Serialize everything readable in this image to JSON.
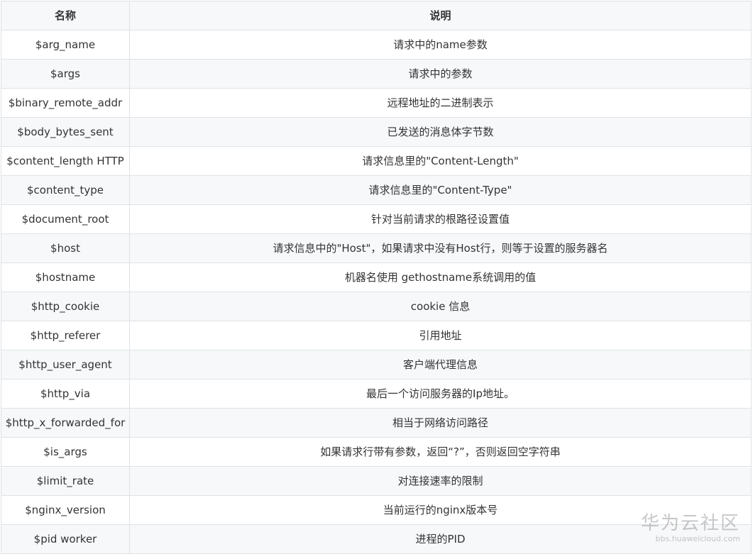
{
  "table": {
    "headers": [
      "名称",
      "说明"
    ],
    "rows": [
      {
        "name": "$arg_name",
        "desc": "请求中的name参数"
      },
      {
        "name": "$args",
        "desc": "请求中的参数"
      },
      {
        "name": "$binary_remote_addr",
        "desc": "远程地址的二进制表示"
      },
      {
        "name": "$body_bytes_sent",
        "desc": "已发送的消息体字节数"
      },
      {
        "name": "$content_length HTTP",
        "desc": "请求信息里的\"Content-Length\""
      },
      {
        "name": "$content_type",
        "desc": "请求信息里的\"Content-Type\""
      },
      {
        "name": "$document_root",
        "desc": "针对当前请求的根路径设置值"
      },
      {
        "name": "$host",
        "desc": "请求信息中的\"Host\"，如果请求中没有Host行，则等于设置的服务器名"
      },
      {
        "name": "$hostname",
        "desc": "机器名使用 gethostname系统调用的值"
      },
      {
        "name": "$http_cookie",
        "desc": "cookie 信息"
      },
      {
        "name": "$http_referer",
        "desc": "引用地址"
      },
      {
        "name": "$http_user_agent",
        "desc": "客户端代理信息"
      },
      {
        "name": "$http_via",
        "desc": "最后一个访问服务器的Ip地址。"
      },
      {
        "name": "$http_x_forwarded_for",
        "desc": "相当于网络访问路径"
      },
      {
        "name": "$is_args",
        "desc": "如果请求行带有参数，返回“?”，否则返回空字符串"
      },
      {
        "name": "$limit_rate",
        "desc": "对连接速率的限制"
      },
      {
        "name": "$nginx_version",
        "desc": "当前运行的nginx版本号"
      },
      {
        "name": "$pid worker",
        "desc": "进程的PID"
      }
    ]
  },
  "watermark": {
    "brand": "华为云社区",
    "url": "bbs.huaweicloud.com"
  },
  "colors": {
    "header_bg": "#f6f8fa",
    "stripe_bg": "#f6f8fa",
    "border": "#dfe2e5",
    "text": "#333333"
  }
}
